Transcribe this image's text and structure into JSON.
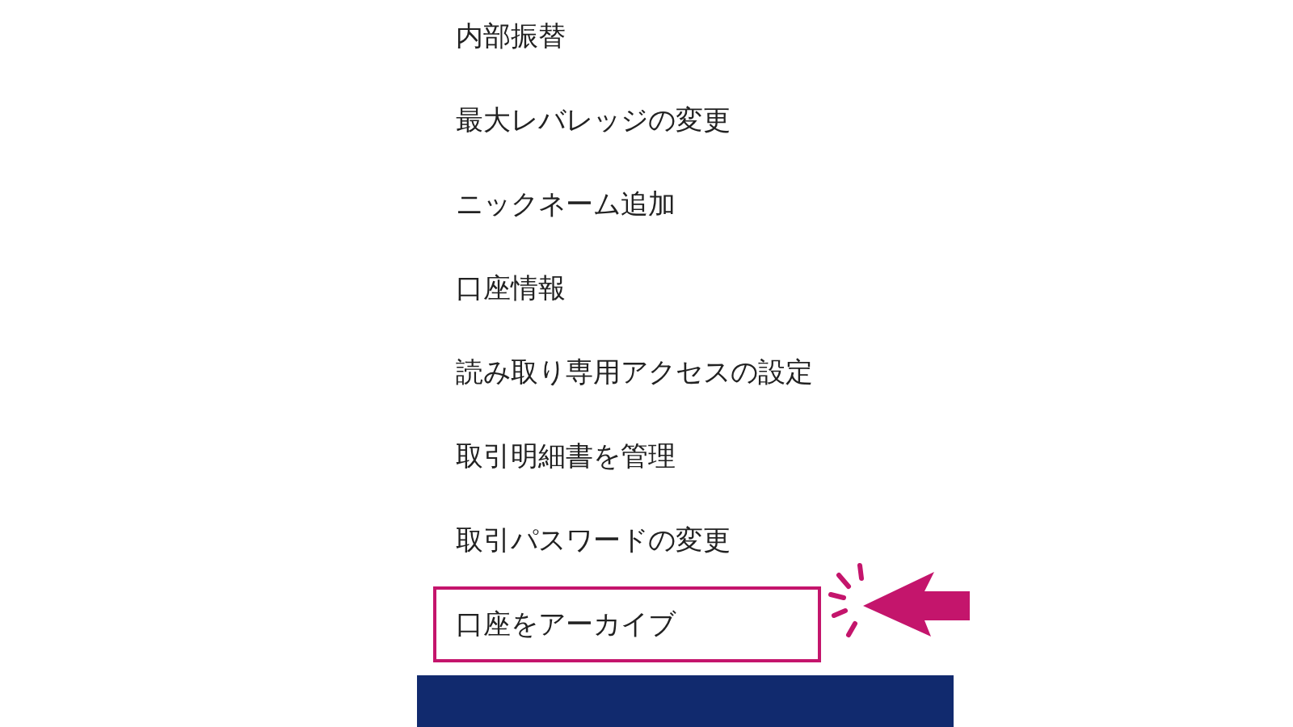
{
  "menu": {
    "items": [
      {
        "label": "内部振替",
        "highlighted": false
      },
      {
        "label": "最大レバレッジの変更",
        "highlighted": false
      },
      {
        "label": "ニックネーム追加",
        "highlighted": false
      },
      {
        "label": "口座情報",
        "highlighted": false
      },
      {
        "label": "読み取り専用アクセスの設定",
        "highlighted": false
      },
      {
        "label": "取引明細書を管理",
        "highlighted": false
      },
      {
        "label": "取引パスワードの変更",
        "highlighted": false
      },
      {
        "label": "口座をアーカイブ",
        "highlighted": true
      }
    ]
  }
}
